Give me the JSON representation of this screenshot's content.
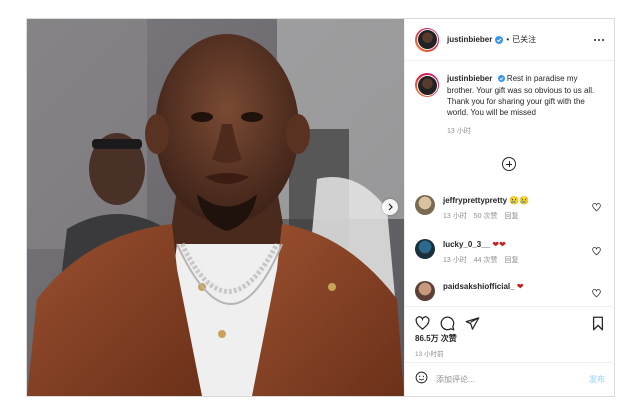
{
  "post": {
    "author": "justinbieber",
    "follow_status": "已关注",
    "caption_text": "Rest in paradise my brother. Your gift was so obvious to us all. Thank you for sharing your gift with the world. You will be missed",
    "caption_time": "13 小时",
    "likes": "86.5万 次赞",
    "posted_ago": "13 小时前"
  },
  "comments": [
    {
      "username": "jeffryprettypretty",
      "text": "😢😢",
      "time": "13 小时",
      "likes": "50 次赞",
      "reply": "回复"
    },
    {
      "username": "lucky_0_3__",
      "text": "❤❤",
      "time": "13 小时",
      "likes": "44 次赞",
      "reply": "回复"
    },
    {
      "username": "paidsakshiofficial_",
      "text": "❤"
    }
  ],
  "comment_box": {
    "placeholder": "添加评论...",
    "post_label": "发布"
  },
  "colors": {
    "accent": "#0095f6",
    "heart": "#c4201f",
    "muted": "#8e8e8e"
  },
  "icons": [
    "verified-icon",
    "more-icon",
    "plus-circle-icon",
    "heart-icon",
    "comment-icon",
    "share-icon",
    "bookmark-icon",
    "emoji-icon",
    "chevron-right-icon"
  ]
}
